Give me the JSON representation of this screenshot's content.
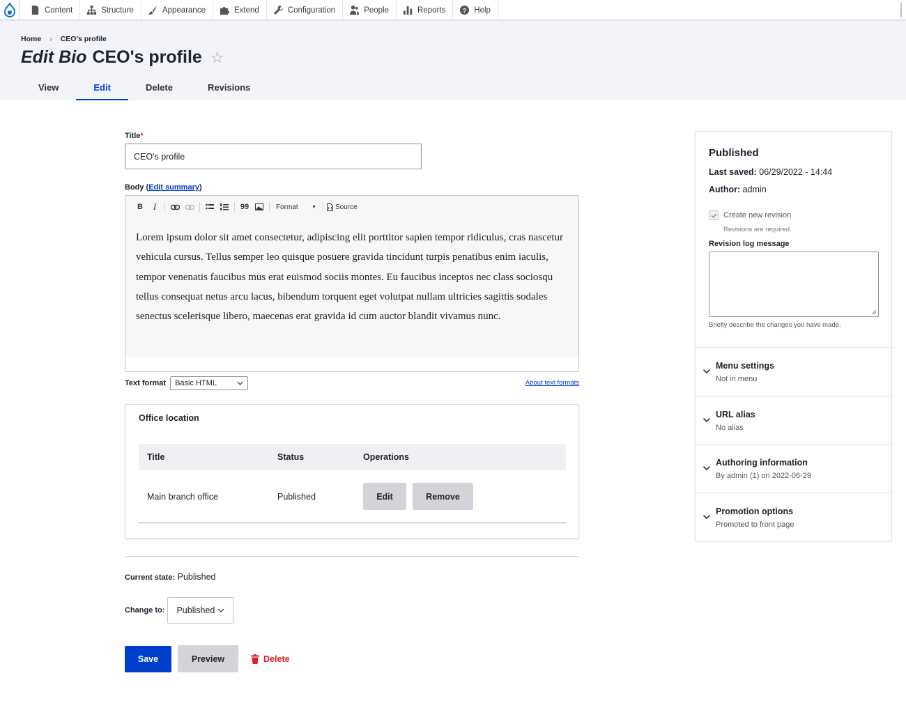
{
  "toolbar": {
    "items": [
      {
        "label": "Content",
        "icon": "file-icon"
      },
      {
        "label": "Structure",
        "icon": "sitemap-icon"
      },
      {
        "label": "Appearance",
        "icon": "brush-icon"
      },
      {
        "label": "Extend",
        "icon": "puzzle-icon"
      },
      {
        "label": "Configuration",
        "icon": "wrench-icon"
      },
      {
        "label": "People",
        "icon": "people-icon"
      },
      {
        "label": "Reports",
        "icon": "bar-chart-icon"
      },
      {
        "label": "Help",
        "icon": "help-icon"
      }
    ]
  },
  "breadcrumb": {
    "home": "Home",
    "separator": "›",
    "current": "CEO's profile"
  },
  "page": {
    "title_prefix": "Edit Bio",
    "title": "CEO's profile",
    "star": "☆"
  },
  "tabs": [
    {
      "label": "View",
      "active": false
    },
    {
      "label": "Edit",
      "active": true
    },
    {
      "label": "Delete",
      "active": false
    },
    {
      "label": "Revisions",
      "active": false
    }
  ],
  "form": {
    "title_label": "Title",
    "required_mark": "*",
    "title_value": "CEO's profile",
    "body_label_prefix": "Body (",
    "body_edit_summary": "Edit summary",
    "body_label_suffix": ")",
    "editor": {
      "bold": "B",
      "italic": "I",
      "quote": "99",
      "format_label": "Format",
      "source_label": "Source",
      "content": "Lorem ipsum dolor sit amet consectetur, adipiscing elit porttitor sapien tempor ridiculus, cras nascetur vehicula cursus. Tellus semper leo quisque posuere gravida tincidunt turpis penatibus enim iaculis, tempor venenatis faucibus mus erat euismod sociis montes. Eu faucibus inceptos nec class sociosqu tellus consequat netus arcu lacus, bibendum torquent eget volutpat nullam ultricies sagittis sodales senectus scelerisque libero, maecenas erat gravida id cum auctor blandit vivamus nunc."
    },
    "text_format_label": "Text format",
    "text_format_value": "Basic HTML",
    "about_text_formats": "About text formats"
  },
  "office": {
    "title": "Office location",
    "columns": [
      "Title",
      "Status",
      "Operations"
    ],
    "rows": [
      {
        "title": "Main branch office",
        "status": "Published",
        "edit": "Edit",
        "remove": "Remove"
      }
    ]
  },
  "moderation": {
    "current_state_label": "Current state:",
    "current_state_value": "Published",
    "change_to_label": "Change to:",
    "change_to_value": "Published"
  },
  "actions": {
    "save": "Save",
    "preview": "Preview",
    "delete": "Delete"
  },
  "sidebar": {
    "status": "Published",
    "last_saved_label": "Last saved:",
    "last_saved_value": "06/29/2022 - 14:44",
    "author_label": "Author:",
    "author_value": "admin",
    "create_revision_label": "Create new revision",
    "create_revision_checked": true,
    "revisions_required": "Revisions are required.",
    "revision_log_label": "Revision log message",
    "revision_log_help": "Briefly describe the changes you have made.",
    "sections": [
      {
        "title": "Menu settings",
        "summary": "Not in menu"
      },
      {
        "title": "URL alias",
        "summary": "No alias"
      },
      {
        "title": "Authoring information",
        "summary": "By admin (1) on 2022-06-29"
      },
      {
        "title": "Promotion options",
        "summary": "Promoted to front page"
      }
    ]
  },
  "colors": {
    "primary": "#003ecc",
    "danger": "#d72222",
    "header_bg": "#f3f4f9"
  }
}
